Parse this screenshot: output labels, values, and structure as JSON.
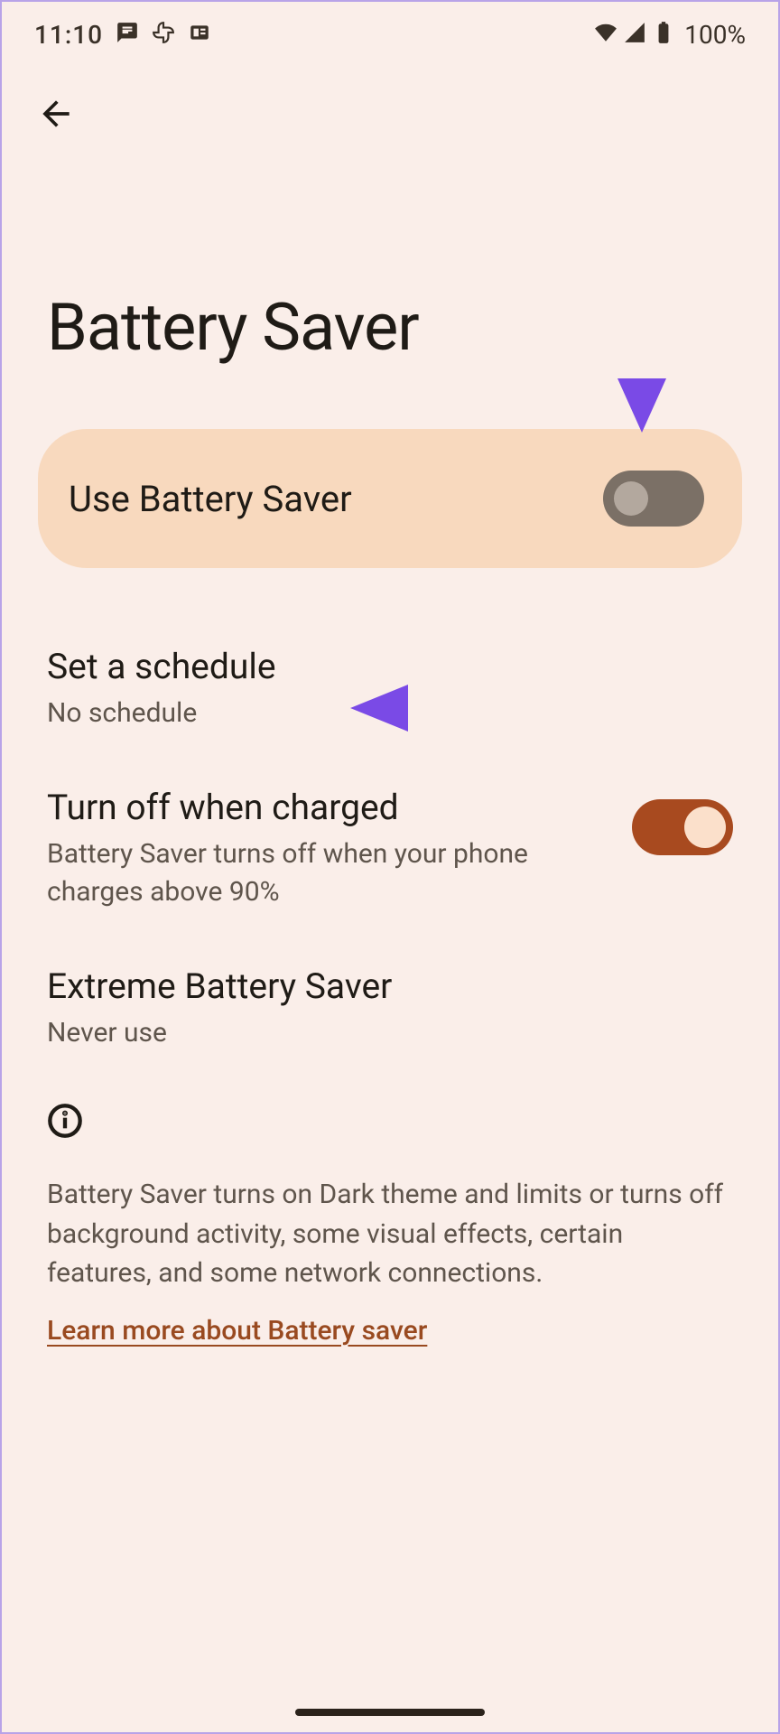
{
  "statusbar": {
    "time": "11:10",
    "battery_text": "100%"
  },
  "header": {
    "title": "Battery Saver"
  },
  "card": {
    "label": "Use Battery Saver",
    "on": false
  },
  "settings": {
    "schedule": {
      "label": "Set a schedule",
      "sub": "No schedule"
    },
    "turnoff": {
      "label": "Turn off when charged",
      "sub": "Battery Saver turns off when your phone charges above 90%",
      "on": true
    },
    "extreme": {
      "label": "Extreme Battery Saver",
      "sub": "Never use"
    }
  },
  "info": {
    "text": "Battery Saver turns on Dark theme and limits or turns off background activity, some visual effects, certain features, and some network connections.",
    "link": "Learn more about Battery saver"
  }
}
